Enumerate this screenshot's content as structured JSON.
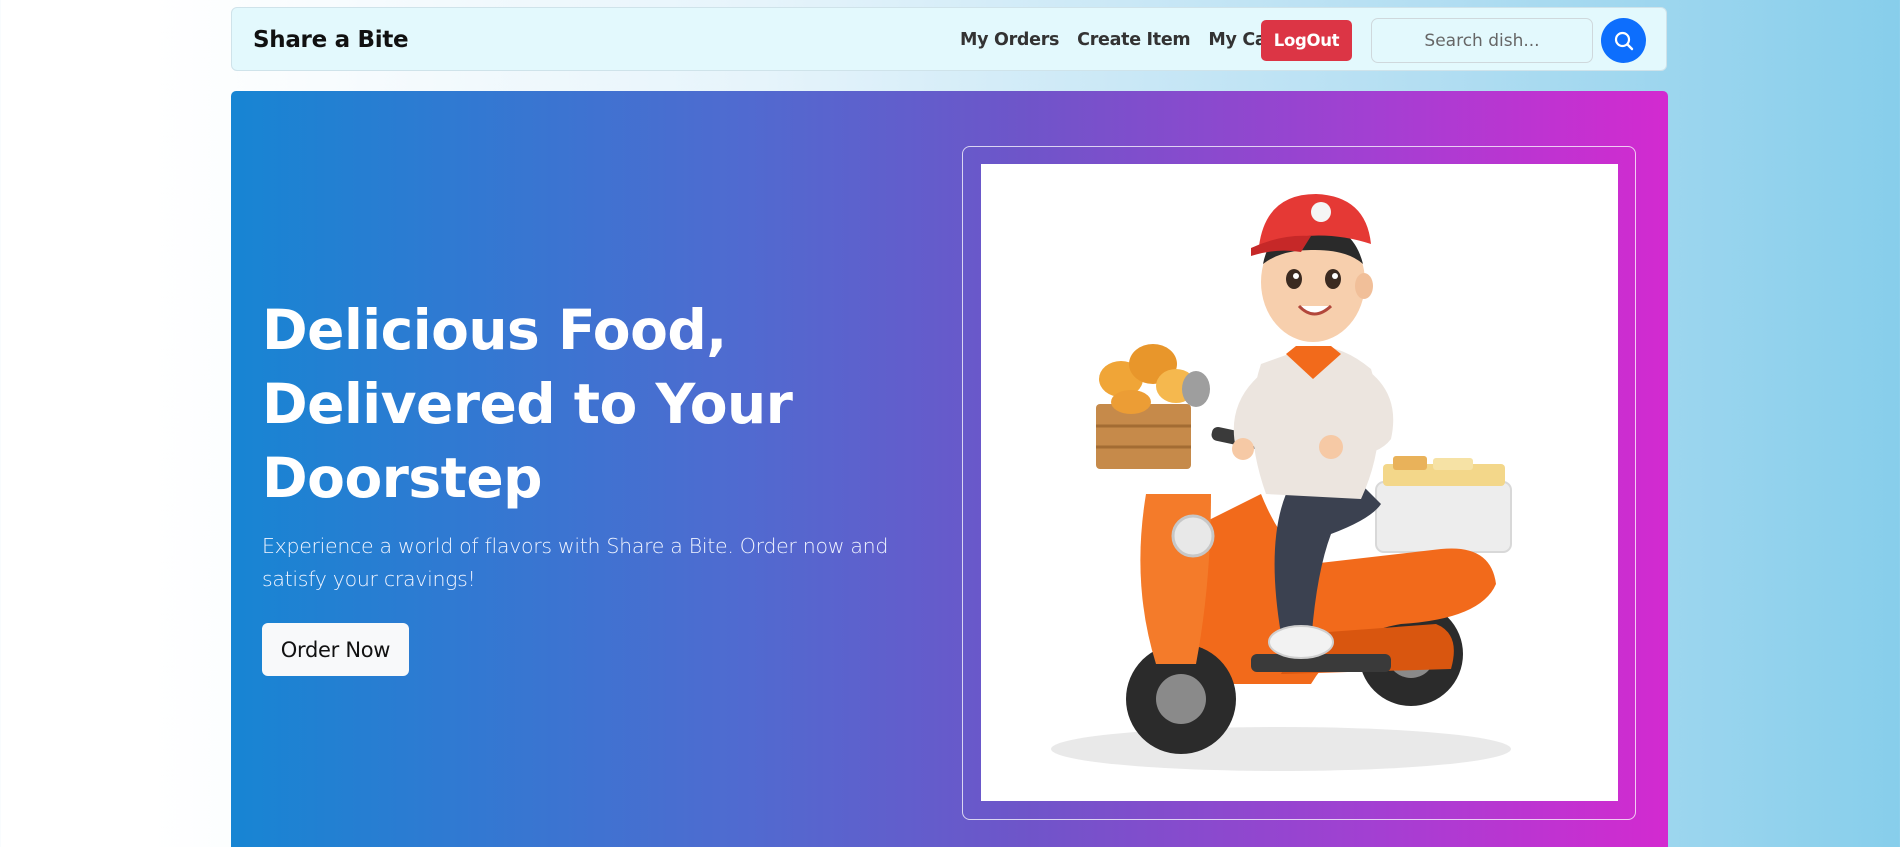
{
  "navbar": {
    "brand": "Share a Bite",
    "links": [
      "My Orders",
      "Create Item",
      "My Cart"
    ],
    "logout_label": "LogOut",
    "search_placeholder": "Search dish...",
    "search_icon": "search-icon"
  },
  "hero": {
    "title": "Delicious Food, Delivered to Your Doorstep",
    "subtitle": "Experience a world of flavors with Share a Bite. Order now and satisfy your cravings!",
    "cta_label": "Order Now",
    "image_icon": "delivery-scooter-illustration"
  },
  "colors": {
    "navbar_bg": "#e3f9fd",
    "logout": "#dc3545",
    "search_button": "#0d6efd",
    "hero_gradient_start": "#1785d3",
    "hero_gradient_end": "#d32ad0",
    "scooter": "#f26a1b",
    "helmet": "#e53935"
  }
}
